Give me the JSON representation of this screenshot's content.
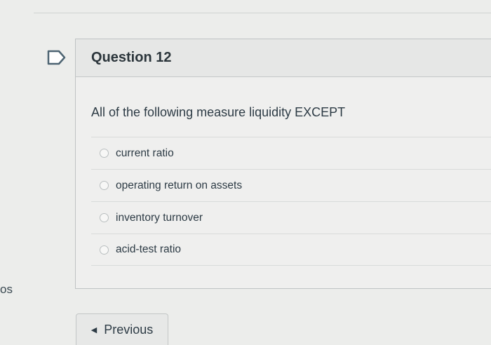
{
  "question": {
    "title": "Question 12",
    "text": "All of the following measure liquidity EXCEPT",
    "answers": [
      {
        "label": "current ratio"
      },
      {
        "label": "operating return on assets"
      },
      {
        "label": "inventory turnover"
      },
      {
        "label": "acid-test ratio"
      }
    ]
  },
  "navigation": {
    "previous_label": "Previous"
  },
  "left_fragment": "os",
  "icons": {
    "flag": "flag-icon",
    "radio": "radio-icon",
    "previous_arrow": "left-arrow-icon"
  },
  "colors": {
    "background": "#ecedeb",
    "header_bg": "#e6e7e6",
    "text": "#2d3b45"
  }
}
